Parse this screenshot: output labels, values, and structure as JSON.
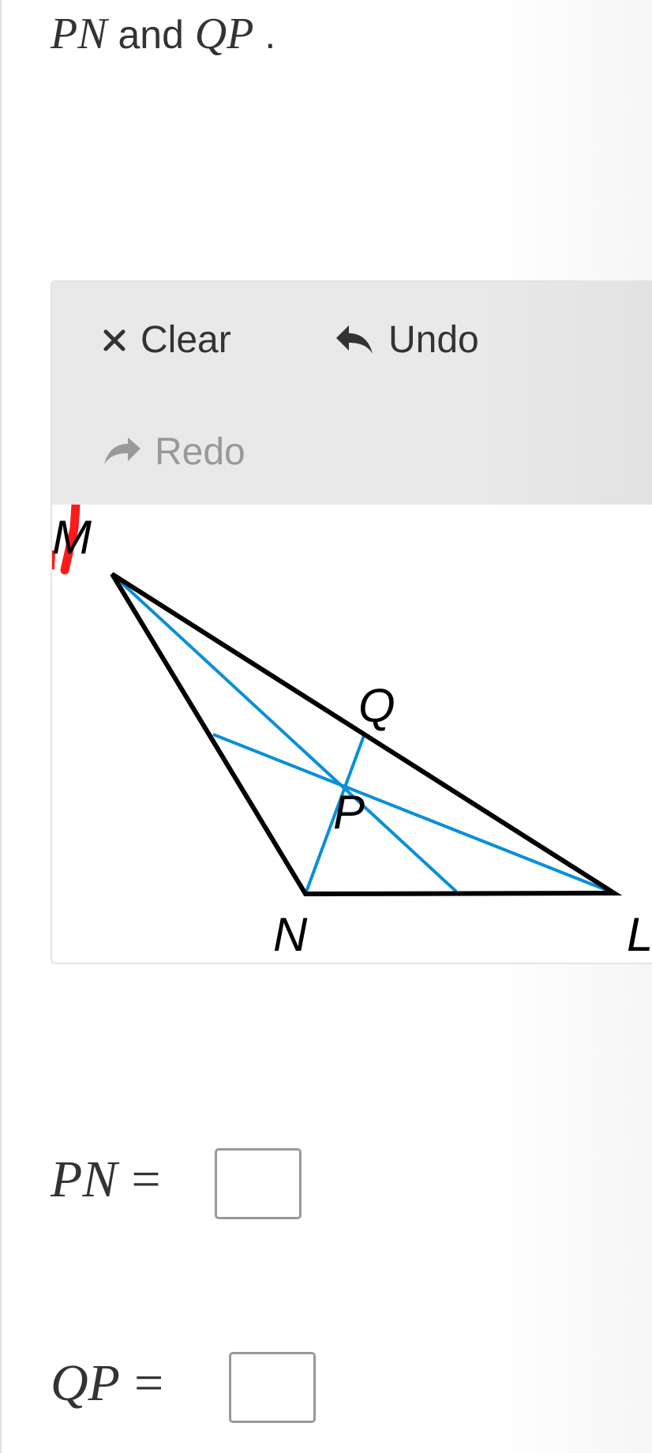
{
  "prompt": {
    "segment_1_math": "PN",
    "segment_2_text": " and ",
    "segment_3_math": "QP",
    "segment_4_text": " ."
  },
  "toolbar": {
    "clear_label": "Clear",
    "undo_label": "Undo",
    "redo_label": "Redo",
    "redo_disabled": true
  },
  "diagram": {
    "vertex_labels": {
      "M": "M",
      "Q": "Q",
      "P": "P",
      "N": "N",
      "L": "L"
    },
    "colors": {
      "triangle": "#000000",
      "medians": "#0a8fd8",
      "annotation": "#ff1a1a"
    }
  },
  "answers": [
    {
      "label": "PN",
      "equals": "=",
      "value": ""
    },
    {
      "label": "QP",
      "equals": "=",
      "value": ""
    }
  ]
}
